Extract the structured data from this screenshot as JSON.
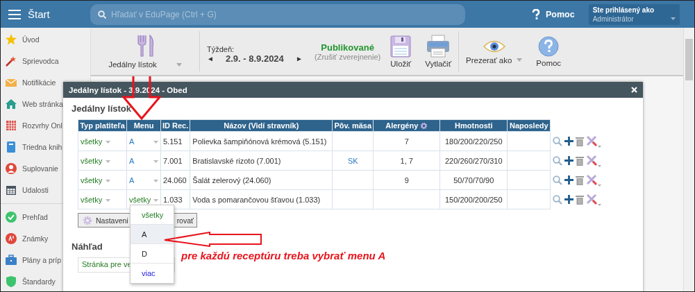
{
  "topbar": {
    "title": "Štart",
    "search_placeholder": "Hľadať v EduPage (Ctrl + G)",
    "help": "Pomoc",
    "login_label": "Ste prihlásený ako",
    "login_role": "Administrátor"
  },
  "sidebar": {
    "groups": [
      [
        {
          "label": "Úvod"
        },
        {
          "label": "Sprievodca"
        },
        {
          "label": "Notifikácie"
        },
        {
          "label": "Web stránka"
        },
        {
          "label": "Rozvrhy Onl"
        },
        {
          "label": "Triedna knih"
        },
        {
          "label": "Suplovanie"
        },
        {
          "label": "Udalosti"
        }
      ],
      [
        {
          "label": "Prehľad"
        },
        {
          "label": "Známky"
        },
        {
          "label": "Plány a príp"
        },
        {
          "label": "Štandardy"
        }
      ]
    ]
  },
  "toolbar": {
    "menu_select": "Jedálny lístok",
    "week_label": "Týždeň:",
    "week_prev": "◄",
    "week": "2.9. - 8.9.2024",
    "week_next": "►",
    "status": "Publikované",
    "status_action": "(Zrušiť zverejnenie)",
    "save": "Uložiť",
    "print": "Vytlačiť",
    "view_as": "Prezerať ako",
    "help": "Pomoc"
  },
  "dialog": {
    "title": "Jedálny lístok - 3.9.2024 - Obed",
    "heading": "Jedálny lístok",
    "table": {
      "columns": [
        "Typ platiteľa",
        "Menu",
        "ID Rec.",
        "Názov (Vidí stravník)",
        "Pôv. mäsa",
        "Alergény",
        "Hmotnosti",
        "Naposledy"
      ],
      "rows": [
        {
          "payer": "všetky",
          "menu": {
            "value": "A",
            "kind": "menu"
          },
          "id": "5.151",
          "name": "Polievka šampiňónová krémová (5.151)",
          "allergens": "7",
          "weights": "180/200/220/250"
        },
        {
          "payer": "všetky",
          "menu": {
            "value": "A",
            "kind": "menu"
          },
          "id": "7.001",
          "name": "Bratislavské rizoto (7.001)",
          "meat_origin": "SK",
          "allergens": "1, 7",
          "weights": "220/260/270/310"
        },
        {
          "payer": "všetky",
          "menu": {
            "value": "A",
            "kind": "menu"
          },
          "id": "24.060",
          "name": "Šalát zelerový (24.060)",
          "allergens": "9",
          "weights": "50/70/70/90"
        },
        {
          "payer": "všetky",
          "menu": {
            "value": "všetky",
            "kind": "all"
          },
          "id": "1.033",
          "name": "Voda s pomarančovou šťavou (1.033)",
          "weights": "150/200/200/250"
        }
      ]
    },
    "settings_button": {
      "label_start": "Nastaveni",
      "label_end": "rovať"
    },
    "preview_heading": "Náhľad",
    "preview_field": "Stránka pre ve",
    "dropdown": {
      "options": [
        {
          "label": "všetky",
          "kind": "all",
          "selected": false
        },
        {
          "label": "A",
          "kind": "menu",
          "selected": true
        },
        {
          "label": "D",
          "kind": "menu",
          "selected": false
        },
        {
          "label": "viac",
          "kind": "more",
          "selected": false
        }
      ]
    }
  },
  "annotation": {
    "text": "pre každú receptúru treba vybrať menu A"
  }
}
